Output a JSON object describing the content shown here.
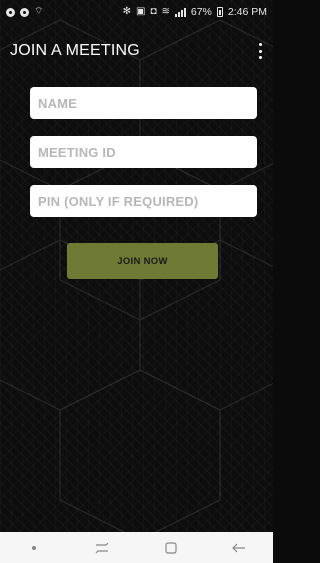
{
  "status_bar": {
    "time": "2:46 PM",
    "battery_percent": "67%"
  },
  "toolbar": {
    "title": "JOIN A MEETING",
    "overflow_icon": "more-vertical-icon"
  },
  "form": {
    "name_placeholder": "NAME",
    "name_value": "",
    "meeting_id_placeholder": "MEETING ID",
    "meeting_id_value": "",
    "pin_placeholder": "PIN (ONLY IF REQUIRED)",
    "pin_value": "",
    "join_label": "JOIN NOW"
  },
  "nav_bar": {
    "items": [
      "nav-dot-icon",
      "recents-icon",
      "home-icon",
      "back-icon"
    ]
  },
  "colors": {
    "background": "#0d0d0d",
    "button": "#6f7a35",
    "field": "#ffffff",
    "placeholder": "#b7b7b7"
  }
}
